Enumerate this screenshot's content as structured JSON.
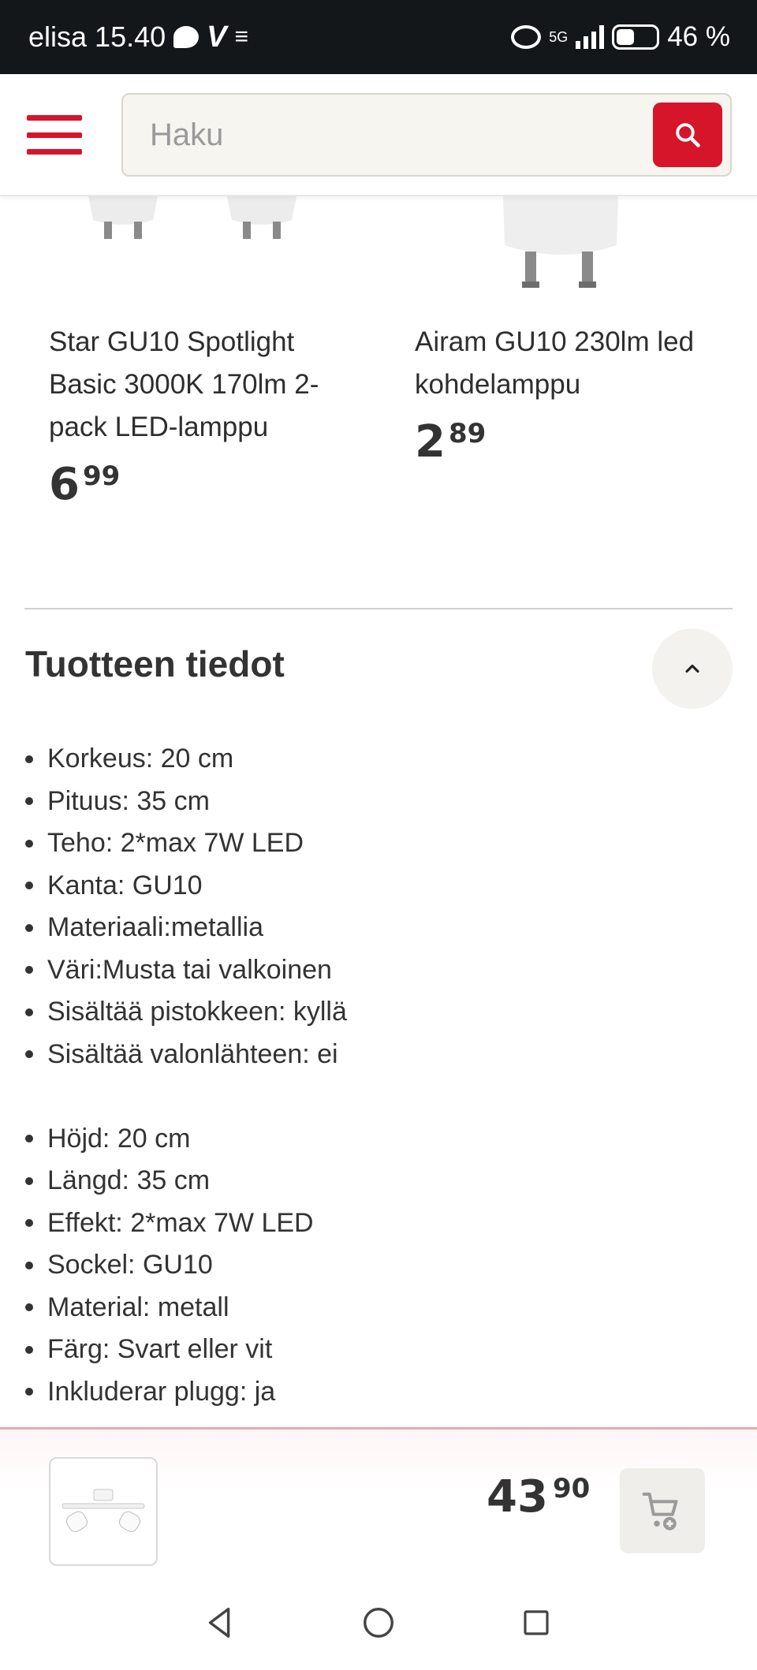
{
  "status_bar": {
    "carrier": "elisa",
    "time": "15.40",
    "network": "5G",
    "battery": "46 %",
    "battery_level": 0.46
  },
  "header": {
    "search_placeholder": "Haku",
    "icons": [
      "menu-icon",
      "search-icon"
    ],
    "accent_color": "#d6152a"
  },
  "related_products": [
    {
      "title": "Star GU10 Spotlight Basic 3000K 170lm 2-pack LED-lamppu",
      "price_whole": "6",
      "price_cents": "99"
    },
    {
      "title": "Airam GU10 230lm led kohdelamppu",
      "price_whole": "2",
      "price_cents": "89"
    }
  ],
  "product_details": {
    "title": "Tuotteen tiedot",
    "items_fi": [
      "Korkeus: 20 cm",
      "Pituus: 35 cm",
      "Teho: 2*max 7W LED",
      "Kanta: GU10",
      "Materiaali:metallia",
      "Väri:Musta tai valkoinen",
      "Sisältää pistokkeen: kyllä",
      "Sisältää valonlähteen: ei"
    ],
    "items_sv": [
      "Höjd: 20 cm",
      "Längd: 35 cm",
      "Effekt: 2*max 7W LED",
      "Sockel: GU10",
      "Material: metall",
      "Färg: Svart eller vit",
      "Inkluderar plugg: ja"
    ]
  },
  "sticky_bar": {
    "price_whole": "43",
    "price_cents": "90",
    "icons": [
      "product-thumbnail",
      "add-to-cart-icon"
    ]
  },
  "nav_bar": {
    "icons": [
      "back-icon",
      "home-icon",
      "recents-icon"
    ]
  }
}
